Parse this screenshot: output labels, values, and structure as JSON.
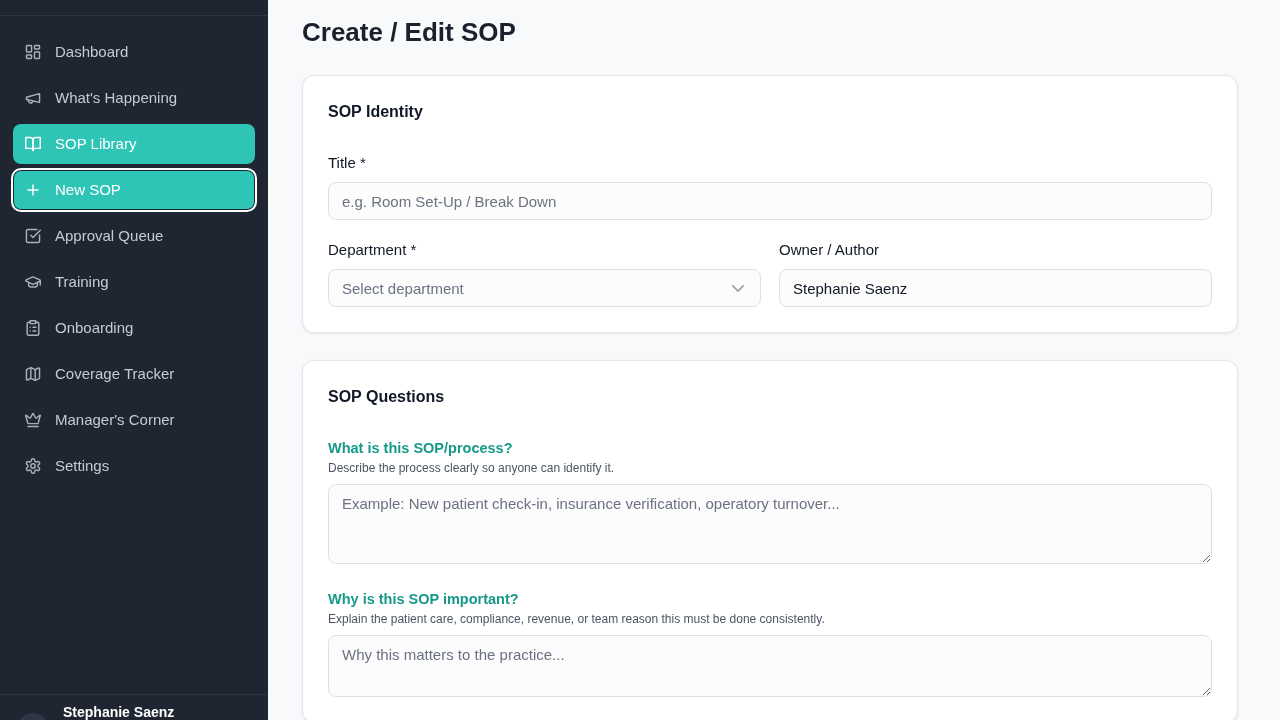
{
  "sidebar": {
    "items": [
      {
        "label": "Dashboard",
        "selected": false,
        "focused": false
      },
      {
        "label": "What's Happening",
        "selected": false,
        "focused": false
      },
      {
        "label": "SOP Library",
        "selected": true,
        "focused": false
      },
      {
        "label": "New SOP",
        "selected": true,
        "focused": true
      },
      {
        "label": "Approval Queue",
        "selected": false,
        "focused": false
      },
      {
        "label": "Training",
        "selected": false,
        "focused": false
      },
      {
        "label": "Onboarding",
        "selected": false,
        "focused": false
      },
      {
        "label": "Coverage Tracker",
        "selected": false,
        "focused": false
      },
      {
        "label": "Manager's Corner",
        "selected": false,
        "focused": false
      },
      {
        "label": "Settings",
        "selected": false,
        "focused": false
      }
    ],
    "user": {
      "name": "Stephanie Saenz"
    }
  },
  "page": {
    "title": "Create / Edit SOP"
  },
  "sop_identity": {
    "heading": "SOP Identity",
    "fields": [
      {
        "kind": "text",
        "label": "Title *",
        "placeholder": "e.g. Room Set-Up / Break Down"
      },
      {
        "kind": "select",
        "label": "Department *",
        "placeholder": "Select department"
      },
      {
        "kind": "text",
        "label": "Owner / Author",
        "value": "Stephanie Saenz"
      }
    ]
  },
  "sop_questions": {
    "heading": "SOP Questions",
    "questions": [
      {
        "question": "What is this SOP/process?",
        "hint": "Describe the process clearly so anyone can identify it.",
        "placeholder": "Example: New patient check-in, insurance verification, operatory turnover..."
      },
      {
        "question": "Why is this SOP important?",
        "hint": "Explain the patient care, compliance, revenue, or team reason this must be done consistently.",
        "placeholder": "Why this matters to the practice..."
      }
    ]
  }
}
